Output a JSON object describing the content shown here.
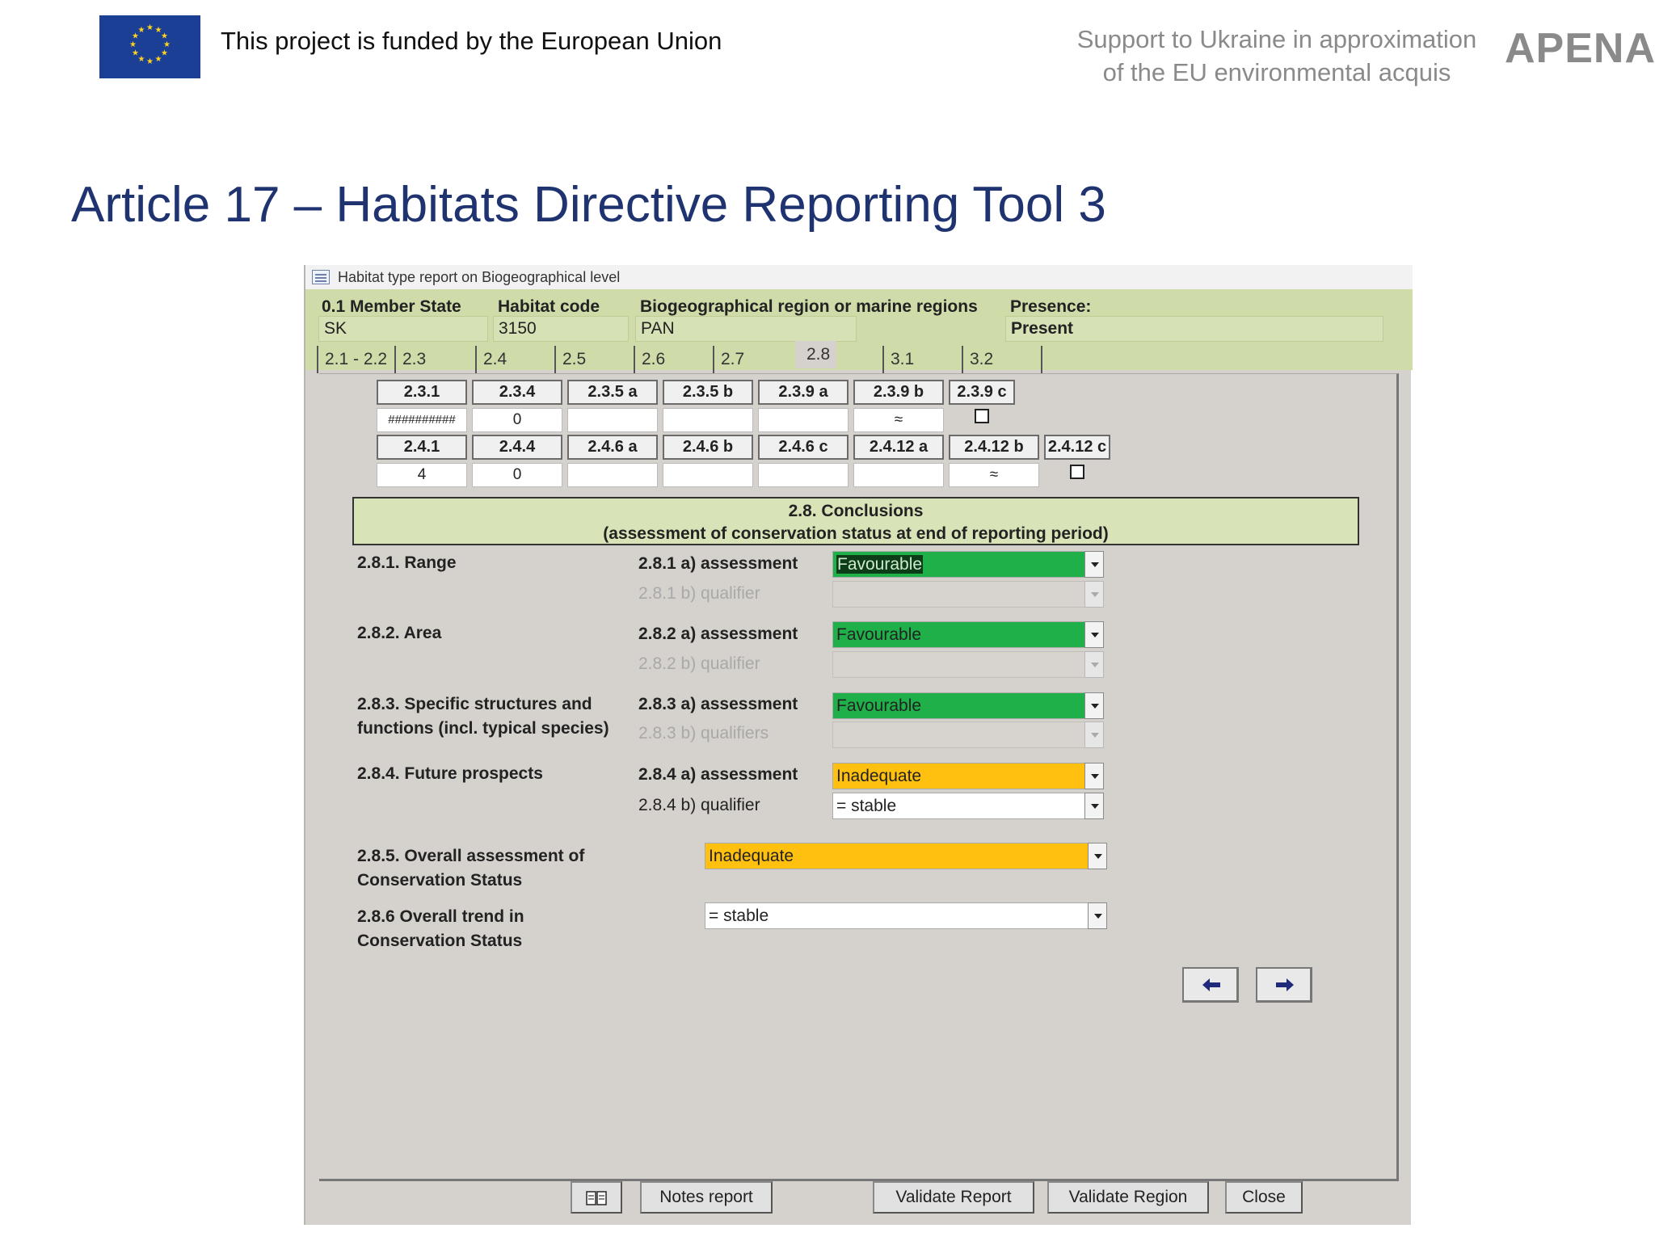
{
  "header": {
    "funded_text": "This project is funded by the European Union",
    "support_line1": "Support to Ukraine in approximation",
    "support_line2": "of the EU environmental acquis",
    "brand": "APENA"
  },
  "slide": {
    "title": "Article 17 – Habitats Directive Reporting Tool 3"
  },
  "window": {
    "title": "Habitat type report on Biogeographical level",
    "fields": {
      "member_state": {
        "label": "0.1 Member State",
        "value": "SK"
      },
      "habitat_code": {
        "label": "Habitat code",
        "value": "3150"
      },
      "region": {
        "label": "Biogeographical region or marine regions",
        "value": "PAN"
      },
      "presence": {
        "label": "Presence:",
        "value": "Present"
      }
    },
    "tabs": [
      "2.1 - 2.2",
      "2.3",
      "2.4",
      "2.5",
      "2.6",
      "2.7",
      "2.8",
      "3.1",
      "3.2"
    ],
    "active_tab": "2.8",
    "grid_row1": {
      "headers": [
        "2.3.1",
        "2.3.4",
        "2.3.5 a",
        "2.3.5 b",
        "2.3.9 a",
        "2.3.9 b",
        "2.3.9 c"
      ],
      "values": [
        "##########",
        "0",
        "",
        "",
        "",
        "≈",
        ""
      ]
    },
    "grid_row2": {
      "headers": [
        "2.4.1",
        "2.4.4",
        "2.4.6 a",
        "2.4.6 b",
        "2.4.6 c",
        "2.4.12 a",
        "2.4.12 b",
        "2.4.12 c"
      ],
      "values": [
        "4",
        "0",
        "",
        "",
        "",
        "",
        "≈",
        ""
      ]
    },
    "conclusions": {
      "title": "2.8. Conclusions",
      "subtitle": "(assessment of conservation status at end of reporting period)"
    },
    "range": {
      "label": "2.8.1. Range",
      "a_label": "2.8.1 a) assessment",
      "a_value": "Favourable",
      "b_label": "2.8.1 b) qualifier",
      "b_value": ""
    },
    "area": {
      "label": "2.8.2. Area",
      "a_label": "2.8.2 a) assessment",
      "a_value": "Favourable",
      "b_label": "2.8.2 b) qualifier",
      "b_value": ""
    },
    "structures": {
      "label_line1": "2.8.3. Specific structures and",
      "label_line2": "functions (incl. typical species)",
      "a_label": "2.8.3 a) assessment",
      "a_value": "Favourable",
      "b_label": "2.8.3 b) qualifiers",
      "b_value": ""
    },
    "future": {
      "label": "2.8.4. Future prospects",
      "a_label": "2.8.4 a) assessment",
      "a_value": "Inadequate",
      "b_label": "2.8.4 b) qualifier",
      "b_value": "= stable"
    },
    "overall": {
      "label_line1": "2.8.5. Overall assessment of",
      "label_line2": "Conservation Status",
      "value": "Inadequate"
    },
    "trend": {
      "label_line1": "2.8.6 Overall trend in",
      "label_line2": "Conservation Status",
      "value": "= stable"
    },
    "buttons": {
      "notes": "Notes report",
      "validate_report": "Validate Report",
      "validate_region": "Validate Region",
      "close": "Close"
    },
    "icons": {
      "prev": "arrow-left-icon",
      "next": "arrow-right-icon",
      "book": "book-icon"
    },
    "colors": {
      "favourable": "#1fb04a",
      "inadequate": "#ffc010",
      "header_band": "#cfdcaa",
      "title_blue": "#1f3370"
    }
  }
}
